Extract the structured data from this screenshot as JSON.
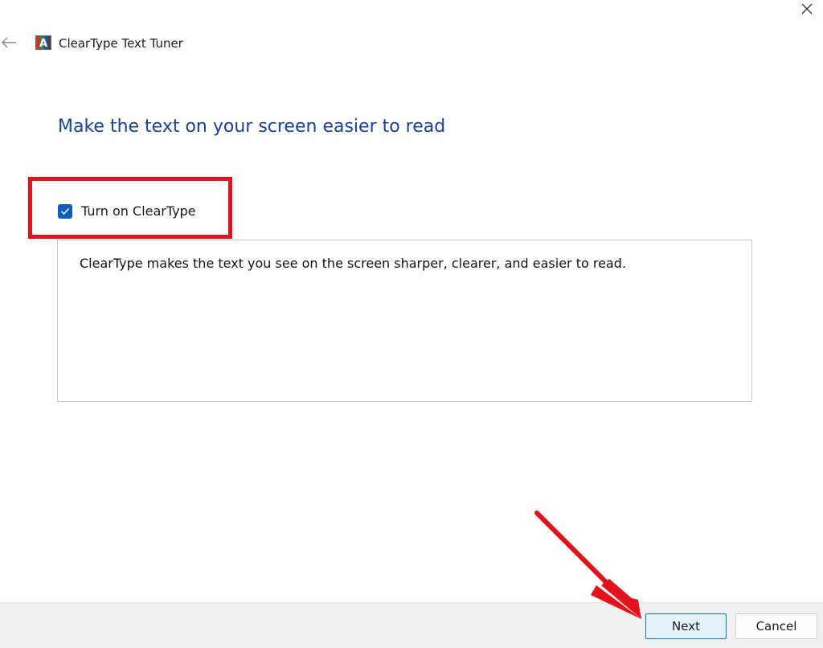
{
  "window": {
    "title": "ClearType Text Tuner",
    "close_icon": "close-icon",
    "back_icon": "back-arrow-icon",
    "app_icon": "cleartype-app-icon"
  },
  "main": {
    "heading": "Make the text on your screen easier to read",
    "checkbox": {
      "label": "Turn on ClearType",
      "checked": true
    },
    "description": "ClearType makes the text you see on the screen sharper, clearer, and easier to read."
  },
  "footer": {
    "next_label": "Next",
    "cancel_label": "Cancel"
  },
  "colors": {
    "heading": "#19409a",
    "checkbox_fill": "#0f5bbd",
    "annotation_red": "#e3121b",
    "next_border": "#0078d4",
    "footer_bg": "#f0f0f0"
  }
}
